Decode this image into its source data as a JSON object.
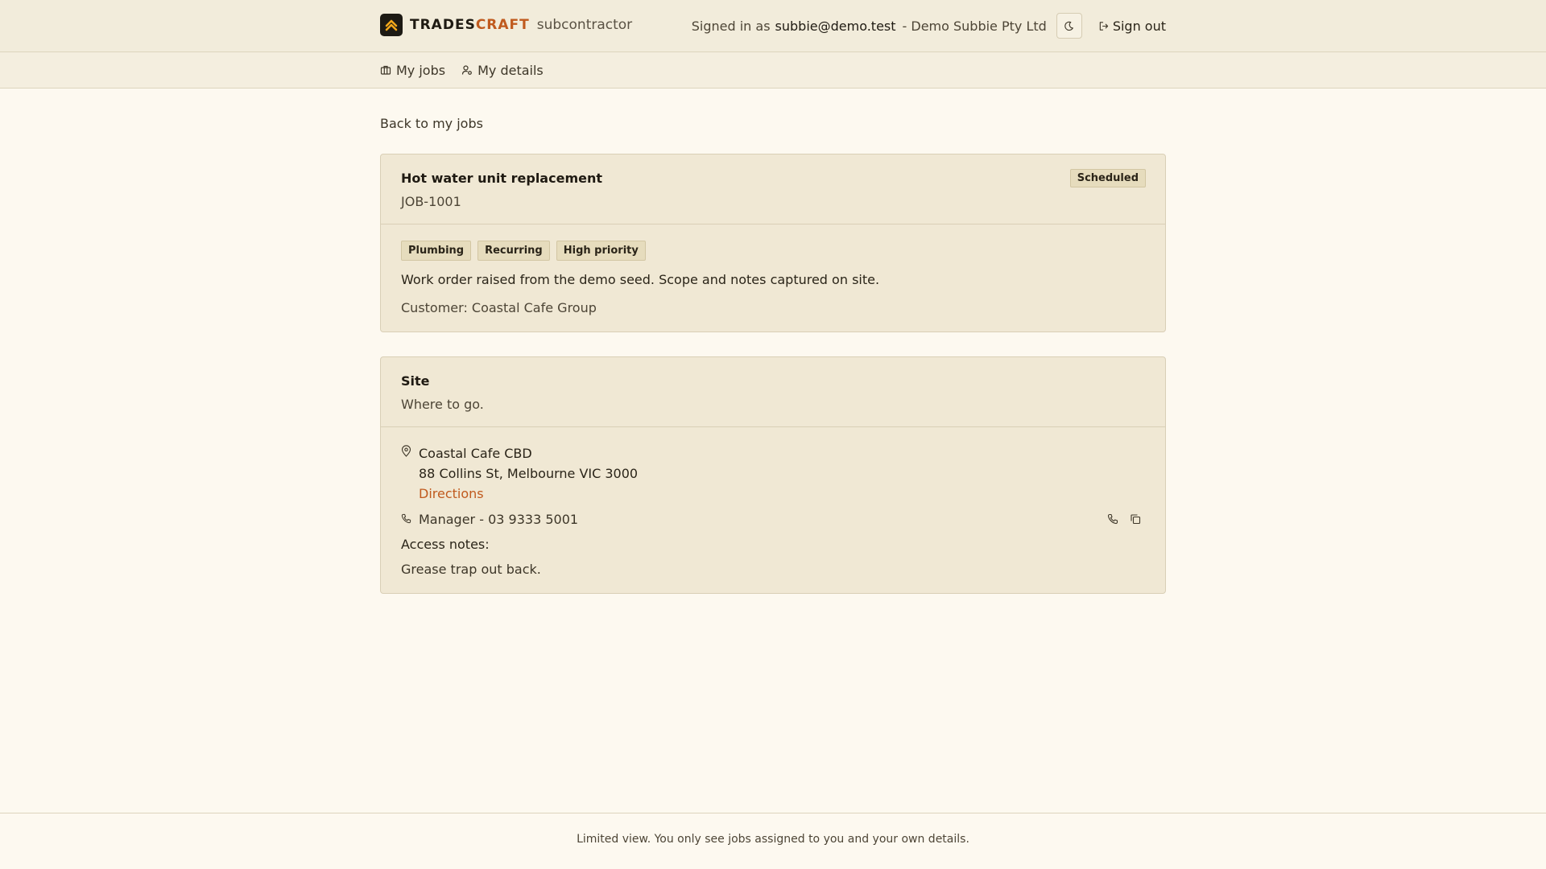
{
  "header": {
    "brand_part1": "TRADES",
    "brand_part2": "CRAFT",
    "brand_sub": "subcontractor",
    "signed_in_label": "Signed in as",
    "email": "subbie@demo.test",
    "company": "- Demo Subbie Pty Ltd",
    "signout_label": "Sign out"
  },
  "nav": {
    "items": [
      {
        "label": "My jobs",
        "icon": "briefcase-icon"
      },
      {
        "label": "My details",
        "icon": "user-gear-icon"
      }
    ]
  },
  "back_label": "Back to my jobs",
  "job": {
    "title": "Hot water unit replacement",
    "id": "JOB-1001",
    "status": "Scheduled",
    "tags": [
      "Plumbing",
      "Recurring",
      "High priority"
    ],
    "description": "Work order raised from the demo seed. Scope and notes captured on site.",
    "customer": "Customer: Coastal Cafe Group"
  },
  "site": {
    "title": "Site",
    "subtitle": "Where to go.",
    "name": "Coastal Cafe CBD",
    "address": "88 Collins St, Melbourne VIC 3000",
    "directions_label": "Directions",
    "contact": "Manager - 03 9333 5001",
    "access_label": "Access notes:",
    "access_text": "Grease trap out back."
  },
  "footer": {
    "text": "Limited view. You only see jobs assigned to you and your own details."
  },
  "colors": {
    "accent": "#c05a1e",
    "logo_bg": "#1d1a14",
    "logo_mark": "#f2a71b"
  }
}
